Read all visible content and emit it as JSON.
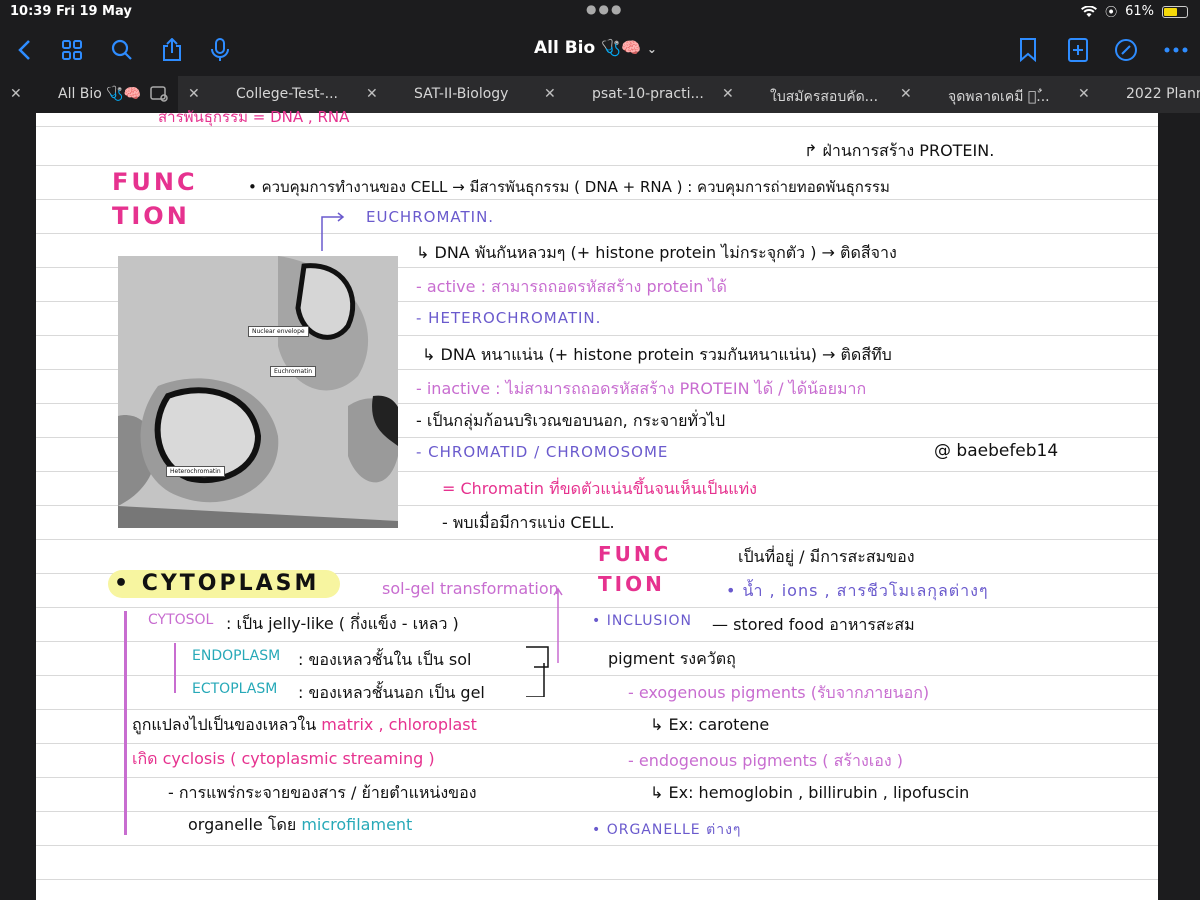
{
  "status_bar": {
    "time": "10:39",
    "date": "Fri 19 May",
    "battery": "61%",
    "battery_fill": 0.61
  },
  "toolbar": {
    "title": "All Bio",
    "title_emoji": "🩺🧠"
  },
  "tabs": [
    {
      "label": "All Bio 🩺🧠",
      "active": true
    },
    {
      "label": "College-Test-..."
    },
    {
      "label": "SAT-II-Biology"
    },
    {
      "label": "psat-10-practi..."
    },
    {
      "label": "ใบสมัครสอบคัด..."
    },
    {
      "label": "จุดพลาดเคมี ०ٌ..."
    },
    {
      "label": "2022 Plann"
    }
  ],
  "notes": {
    "top_cut": "สารพันธุกรรม = DNA , RNA",
    "function_label": "FUNC TION",
    "protein_note": "↱ ฝ่านการสร้าง PROTEIN.",
    "function_line": "• ควบคุมการทำงานของ CELL → มีสารพันธุกรรม ( DNA + RNA ) : ควบคุมการถ่ายทอดพันธุกรรม",
    "euchromatin": "EUCHROMATIN.",
    "euchromatin_desc": "↳ DNA พันกันหลวมๆ (+ histone protein ไม่กระจุกตัว ) → ติดสีจาง",
    "active": "- active : สามารถถอดรหัสสร้าง protein ได้",
    "heterochromatin": "- HETEROCHROMATIN.",
    "heterochromatin_desc": "↳ DNA หนาแน่น (+ histone protein รวมกันหนาแน่น) → ติดสีทึบ",
    "inactive": "- inactive : ไม่สามารถถอดรหัสสร้าง PROTEIN ได้ / ได้น้อยมาก",
    "cluster": "- เป็นกลุ่มก้อนบริเวณขอบนอก, กระจายทั่วไป",
    "chromatid": "- CHROMATID / CHROMOSOME",
    "watermark": "@ baebefeb14",
    "chromatin_coil": "= Chromatin ที่ขดตัวแน่นขึ้นจนเห็นเป็นแท่ง",
    "division": "- พบเมื่อมีการแบ่ง CELL.",
    "cytoplasm": "• CYTOPLASM",
    "solgel": "sol-gel transformation",
    "cytosol": "CYTOSOL",
    "cytosol_desc": ": เป็น jelly-like ( กึ่งแข็ง - เหลว )",
    "endoplasm": "ENDOPLASM",
    "endoplasm_desc": ": ของเหลวชั้นใน เป็น sol",
    "ectoplasm": "ECTOPLASM",
    "ectoplasm_desc": ": ของเหลวชั้นนอก เป็น gel",
    "convert_prefix": "ถูกแปลงไปเป็นของเหลวใน",
    "convert_matrix": "matrix , chloroplast",
    "cyclosis": "เกิด cyclosis ( cytoplasmic streaming )",
    "diffuse": "- การแพร่กระจายของสาร / ย้ายตำแหน่งของ",
    "organelle_by": "organelle โดย",
    "microfilament": "microfilament",
    "func2_label": "FUNC TION",
    "func2_line1": "เป็นที่อยู่ / มีการสะสมของ",
    "func2_line2": "• น้ำ , ions , สารชีวโมเลกุลต่างๆ",
    "inclusion": "• INCLUSION",
    "inclusion_desc": "— stored food อาหารสะสม",
    "pigment": "pigment รงควัตถุ",
    "exogenous": "- exogenous pigments (รับจากภายนอก)",
    "carotene": "↳ Ex: carotene",
    "endogenous": "- endogenous pigments ( สร้างเอง )",
    "endo_ex": "↳ Ex: hemoglobin , billirubin , lipofuscin",
    "organelle": "• ORGANELLE",
    "organelle_th": "ต่างๆ"
  },
  "micrograph": {
    "nuclear_envelope": "Nuclear envelope",
    "euchromatin": "Euchromatin",
    "heterochromatin": "Heterochromatin"
  },
  "colors": {
    "accent": "#2e8cff",
    "purple": "#6a5acd",
    "pink": "#e6328f",
    "lilac": "#c86dd0",
    "teal": "#27a9b8",
    "highlight": "#f7f5a0"
  }
}
